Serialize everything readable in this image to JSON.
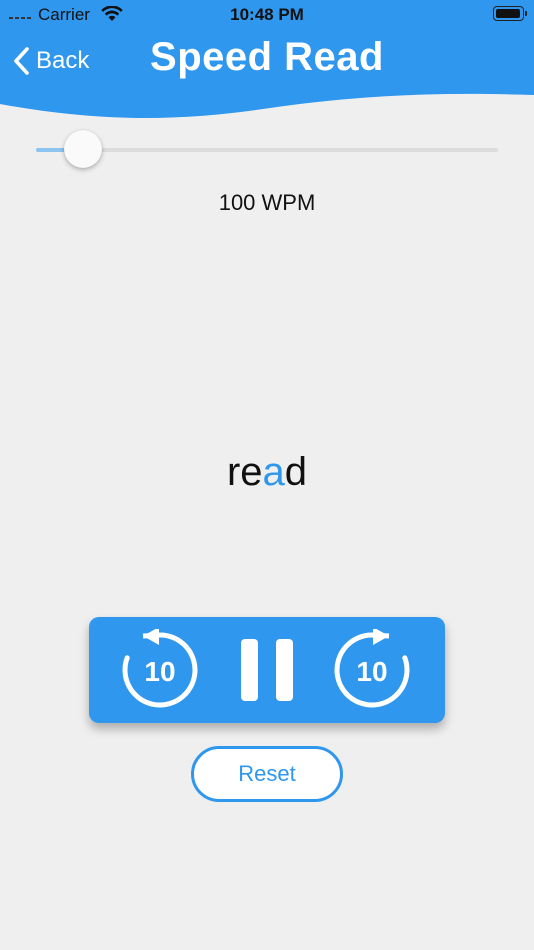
{
  "status_bar": {
    "carrier": "Carrier",
    "time": "10:48 PM"
  },
  "header": {
    "back_label": "Back",
    "title": "Speed Read"
  },
  "speed": {
    "wpm_label": "100 WPM",
    "slider_value_fraction": 0.1
  },
  "reader": {
    "word_before": "re",
    "word_focus": "a",
    "word_after": "d"
  },
  "controls": {
    "skip_back_seconds": "10",
    "skip_forward_seconds": "10",
    "state": "playing"
  },
  "reset_label": "Reset",
  "colors": {
    "accent": "#2f97ee",
    "background": "#efefef"
  },
  "icons": {
    "back": "chevron-left-icon",
    "skip_back": "rotate-back-10-icon",
    "pause": "pause-icon",
    "skip_forward": "rotate-forward-10-icon"
  }
}
